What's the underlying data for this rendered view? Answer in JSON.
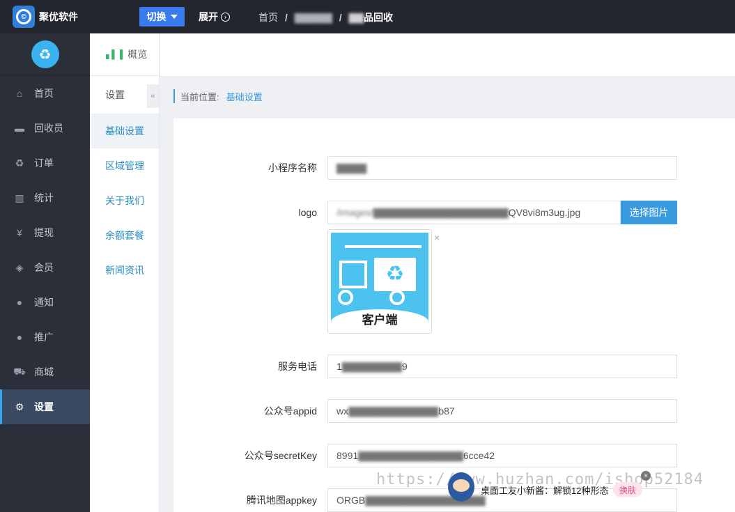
{
  "app": {
    "name": "聚优软件",
    "logo_icon": "copyright-icon"
  },
  "topbar": {
    "switch_label": "切换",
    "expand_label": "展开",
    "breadcrumb": {
      "home": "首页",
      "middle": "",
      "current": "品回收"
    }
  },
  "sidebar": {
    "items": [
      {
        "label": "首页",
        "icon": "home-icon",
        "glyph": "⌂"
      },
      {
        "label": "回收员",
        "icon": "truck-icon",
        "glyph": "▬"
      },
      {
        "label": "订单",
        "icon": "recycle-icon",
        "glyph": "♻"
      },
      {
        "label": "统计",
        "icon": "bar-chart-icon",
        "glyph": "▥"
      },
      {
        "label": "提现",
        "icon": "yen-icon",
        "glyph": "¥"
      },
      {
        "label": "会员",
        "icon": "tag-icon",
        "glyph": "◈"
      },
      {
        "label": "通知",
        "icon": "comment-icon",
        "glyph": "●"
      },
      {
        "label": "推广",
        "icon": "comments-icon",
        "glyph": "●"
      },
      {
        "label": "商城",
        "icon": "cart-icon",
        "glyph": "⛟"
      },
      {
        "label": "设置",
        "icon": "gear-icon",
        "glyph": "⚙"
      }
    ]
  },
  "subnav": {
    "overview": "概览",
    "section_title": "设置",
    "items": [
      {
        "label": "基础设置"
      },
      {
        "label": "区域管理"
      },
      {
        "label": "关于我们"
      },
      {
        "label": "余额套餐"
      },
      {
        "label": "新闻资讯"
      }
    ]
  },
  "location": {
    "prefix": "当前位置:",
    "current": "基础设置"
  },
  "form": {
    "name_label": "小程序名称",
    "name_value": "",
    "logo_label": "logo",
    "logo_value": "QV8vi8m3ug.jpg",
    "logo_button": "选择图片",
    "logo_caption": "客户端",
    "logo_remove": "×",
    "phone_label": "服务电话",
    "phone_value_start": "1",
    "phone_value_end": "9",
    "appid_label": "公众号appid",
    "appid_value_start": "wx",
    "appid_value_end": "b87",
    "secret_label": "公众号secretKey",
    "secret_value_start": "8991",
    "secret_value_end": "6cce42",
    "map_label": "腾讯地图appkey",
    "map_value_start": "ORGB"
  },
  "watermark": {
    "url": "https://www.huzhan.com/ishop52184",
    "promo": "桌面工友小新酱：解锁12种形态",
    "badge": "换肤",
    "close": "×"
  }
}
